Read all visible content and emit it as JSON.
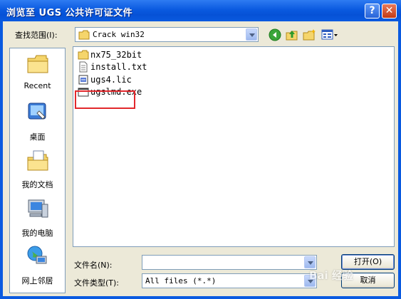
{
  "window": {
    "title": "浏览至 UGS 公共许可证文件",
    "help_glyph": "?",
    "close_glyph": "✕"
  },
  "lookin": {
    "label": "查找范围(I):",
    "value": "Crack win32"
  },
  "places": [
    {
      "label": "Recent",
      "icon": "recent-folder-icon"
    },
    {
      "label": "桌面",
      "icon": "desktop-icon"
    },
    {
      "label": "我的文档",
      "icon": "my-documents-icon"
    },
    {
      "label": "我的电脑",
      "icon": "my-computer-icon"
    },
    {
      "label": "网上邻居",
      "icon": "network-icon"
    }
  ],
  "files": [
    {
      "name": "nx75_32bit",
      "icon": "folder-icon"
    },
    {
      "name": "install.txt",
      "icon": "text-file-icon"
    },
    {
      "name": "ugs4.lic",
      "icon": "license-file-icon"
    },
    {
      "name": "ugslmd.exe",
      "icon": "exe-file-icon"
    }
  ],
  "filename": {
    "label": "文件名(N):",
    "value": ""
  },
  "filetype": {
    "label": "文件类型(T):",
    "value": "All files (*.*)"
  },
  "buttons": {
    "open": "打开(O)",
    "cancel": "取消"
  },
  "watermark": "Bai 经验",
  "colors": {
    "titlebar": "#0a5ae0",
    "face": "#ece9d8",
    "highlight": "#e2282c"
  }
}
